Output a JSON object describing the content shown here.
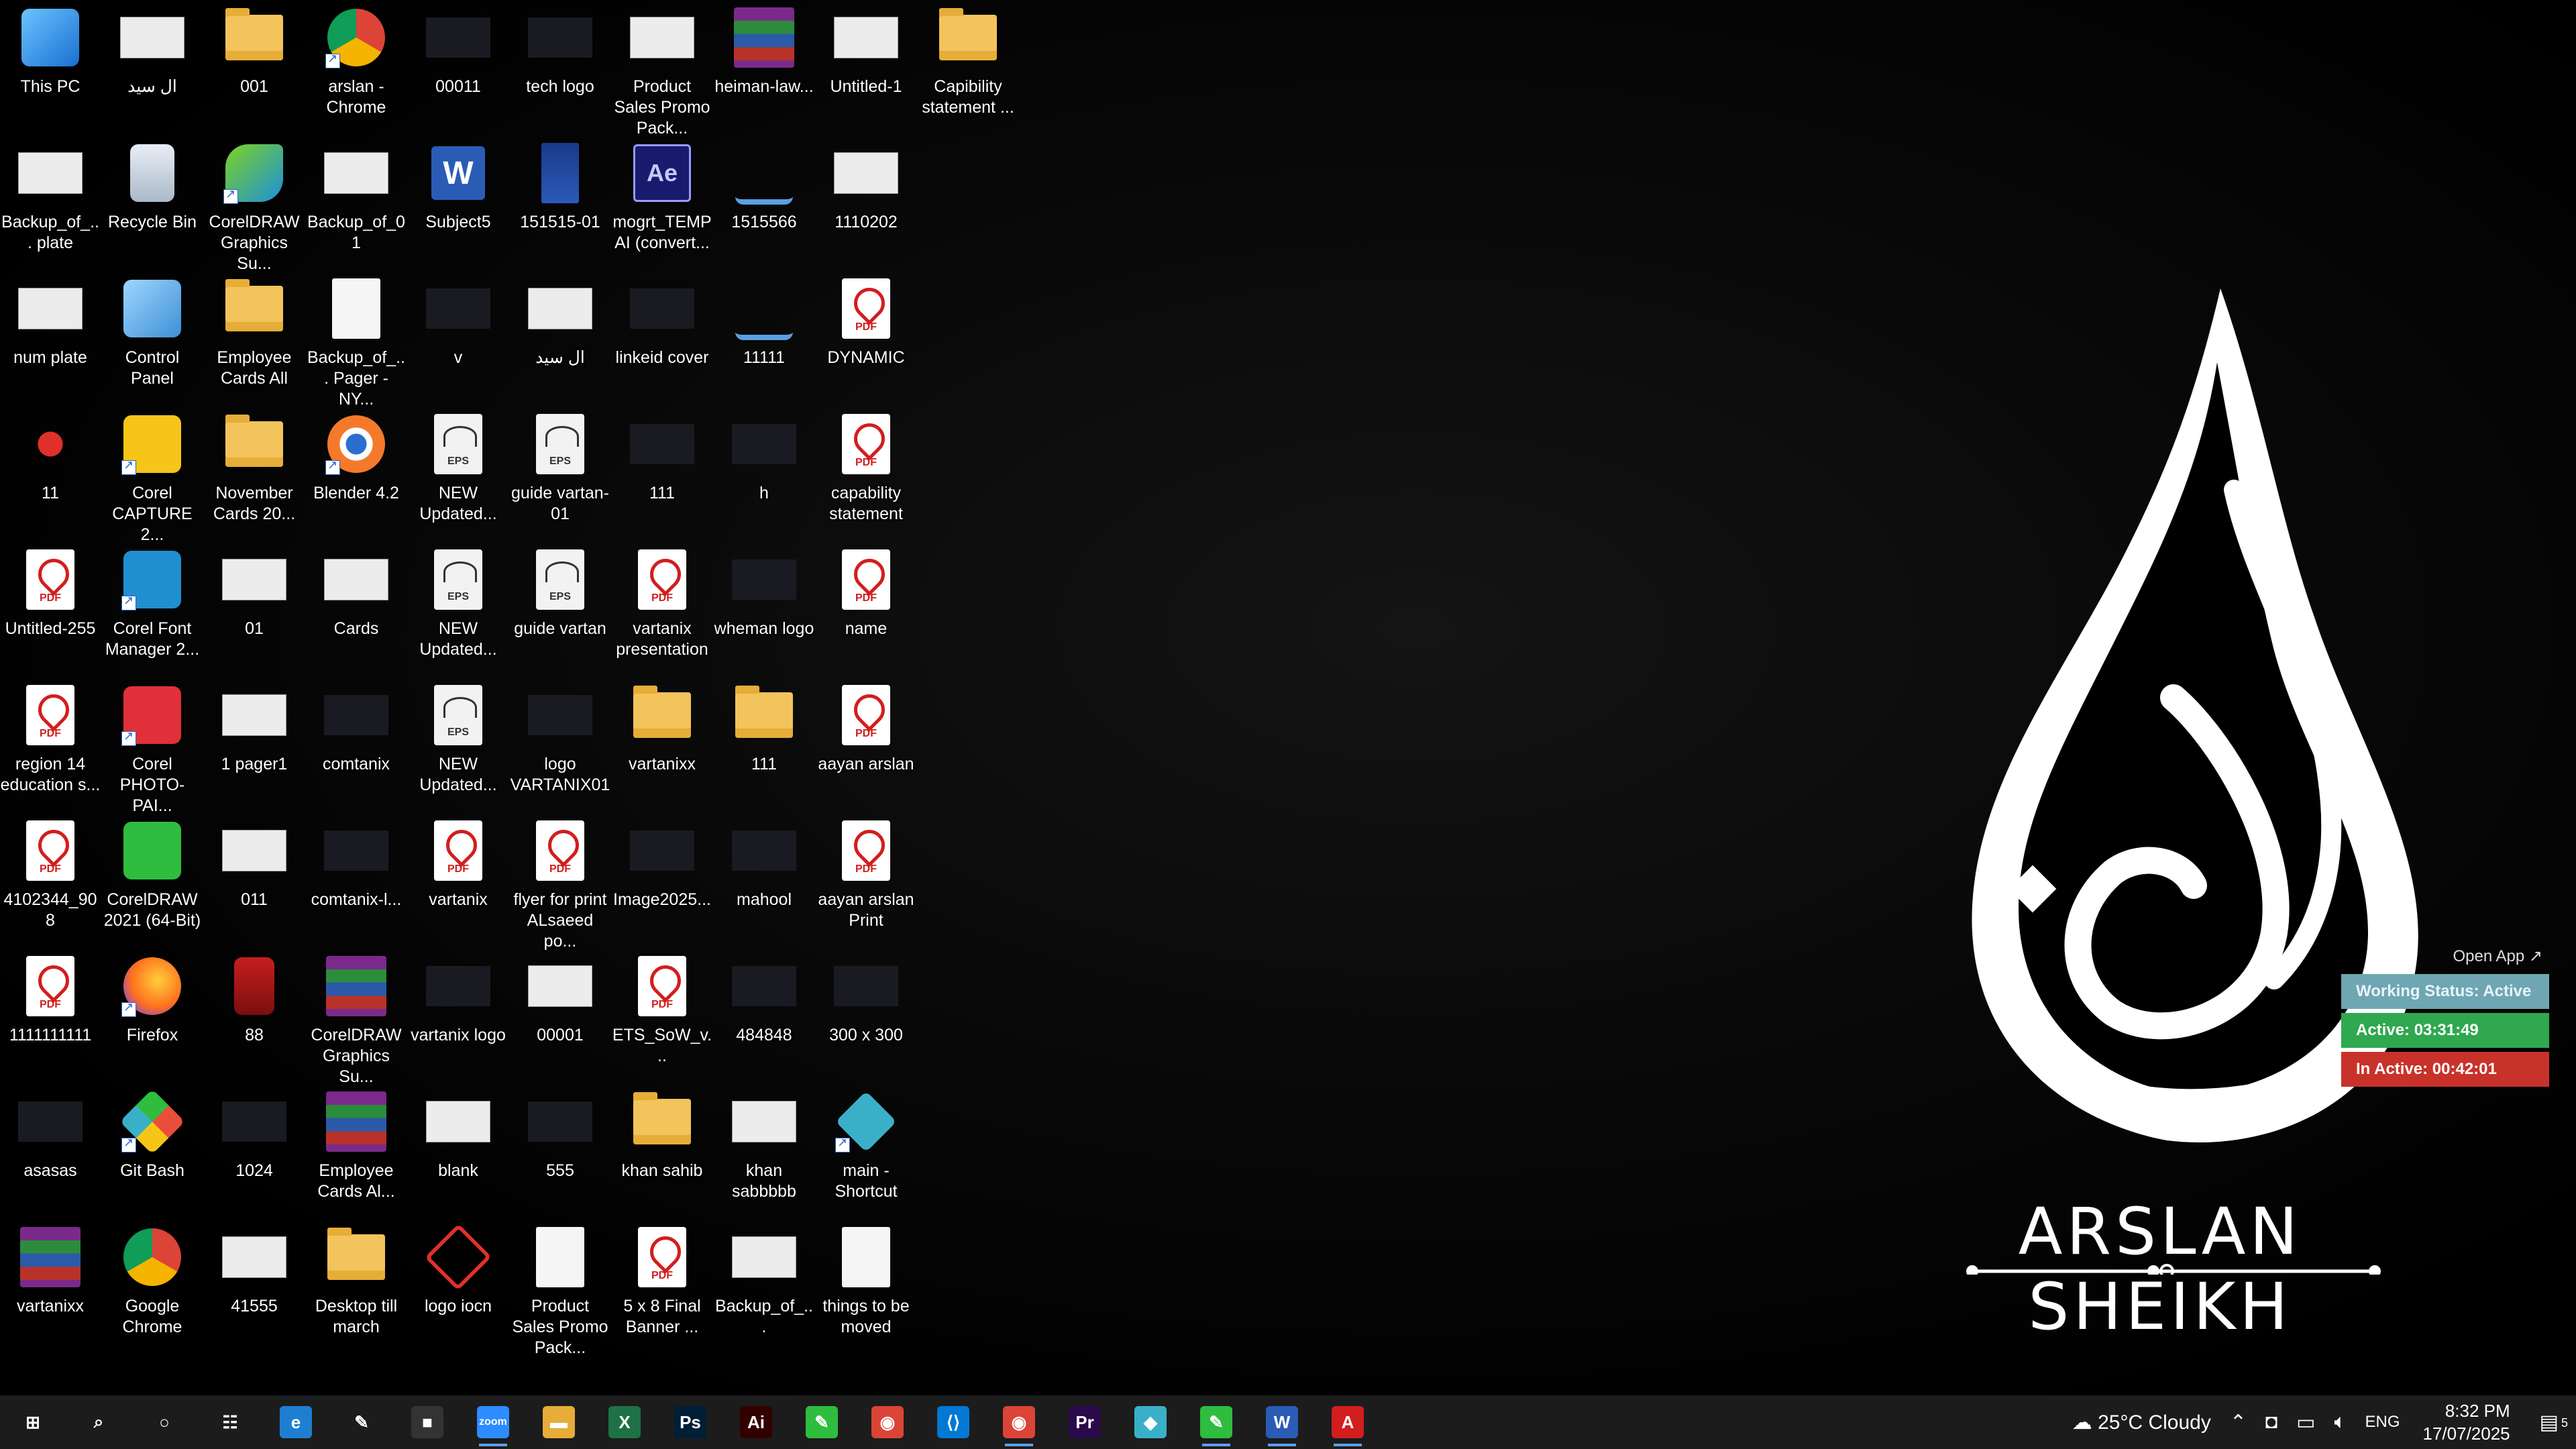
{
  "desktop": {
    "icons": [
      {
        "label": "This PC",
        "kind": "thispc",
        "col": 0,
        "row": 0
      },
      {
        "label": "ال سيد",
        "kind": "thumb",
        "col": 1,
        "row": 0
      },
      {
        "label": "001",
        "kind": "folder",
        "col": 2,
        "row": 0
      },
      {
        "label": "arslan - Chrome",
        "kind": "chrome",
        "col": 3,
        "row": 0,
        "shortcut": true
      },
      {
        "label": "00011",
        "kind": "dark",
        "col": 4,
        "row": 0
      },
      {
        "label": "tech logo",
        "kind": "dark",
        "col": 5,
        "row": 0
      },
      {
        "label": "Product Sales Promo Pack...",
        "kind": "thumb",
        "col": 6,
        "row": 0
      },
      {
        "label": "heiman-law...",
        "kind": "winrar",
        "col": 7,
        "row": 0
      },
      {
        "label": "Untitled-1",
        "kind": "thumb",
        "col": 8,
        "row": 0
      },
      {
        "label": "Capibility statement ...",
        "kind": "folder",
        "col": 9,
        "row": 0
      },
      {
        "label": "Backup_of_... plate",
        "kind": "thumb",
        "col": 0,
        "row": 1
      },
      {
        "label": "Recycle Bin",
        "kind": "recycle",
        "col": 1,
        "row": 1
      },
      {
        "label": "CorelDRAW Graphics Su...",
        "kind": "corel",
        "col": 2,
        "row": 1,
        "shortcut": true
      },
      {
        "label": "Backup_of_01",
        "kind": "thumb",
        "col": 3,
        "row": 1
      },
      {
        "label": "Subject5",
        "kind": "word",
        "col": 4,
        "row": 1
      },
      {
        "label": "151515-01",
        "kind": "bluedoc",
        "col": 5,
        "row": 1
      },
      {
        "label": "mogrt_TEMP AI (convert...",
        "kind": "ae",
        "col": 6,
        "row": 1
      },
      {
        "label": "1515566",
        "kind": "scales",
        "col": 7,
        "row": 1
      },
      {
        "label": "1110202",
        "kind": "thumb",
        "col": 8,
        "row": 1
      },
      {
        "label": "num plate",
        "kind": "thumb",
        "col": 0,
        "row": 2
      },
      {
        "label": "Control Panel",
        "kind": "control",
        "col": 1,
        "row": 2
      },
      {
        "label": "Employee Cards All",
        "kind": "folder",
        "col": 2,
        "row": 2
      },
      {
        "label": "Backup_of_... Pager - NY...",
        "kind": "doc",
        "col": 3,
        "row": 2
      },
      {
        "label": "v",
        "kind": "dark",
        "col": 4,
        "row": 2
      },
      {
        "label": "ال سيد",
        "kind": "thumb",
        "col": 5,
        "row": 2
      },
      {
        "label": "linkeid cover",
        "kind": "dark",
        "col": 6,
        "row": 2
      },
      {
        "label": "11111",
        "kind": "scales",
        "col": 7,
        "row": 2
      },
      {
        "label": "DYNAMIC",
        "kind": "pdf",
        "col": 8,
        "row": 2
      },
      {
        "label": "11",
        "kind": "red11",
        "col": 0,
        "row": 3
      },
      {
        "label": "Corel CAPTURE 2...",
        "kind": "capture",
        "col": 1,
        "row": 3,
        "shortcut": true
      },
      {
        "label": "November Cards 20...",
        "kind": "folder",
        "col": 2,
        "row": 3
      },
      {
        "label": "Blender 4.2",
        "kind": "blender",
        "col": 3,
        "row": 3,
        "shortcut": true
      },
      {
        "label": "NEW Updated...",
        "kind": "eps",
        "col": 4,
        "row": 3
      },
      {
        "label": "guide vartan-01",
        "kind": "eps",
        "col": 5,
        "row": 3
      },
      {
        "label": "111",
        "kind": "dark",
        "col": 6,
        "row": 3
      },
      {
        "label": "h",
        "kind": "dark",
        "col": 7,
        "row": 3
      },
      {
        "label": "capability statement",
        "kind": "pdf",
        "col": 8,
        "row": 3
      },
      {
        "label": "Untitled-255",
        "kind": "pdf",
        "col": 0,
        "row": 4
      },
      {
        "label": "Corel Font Manager 2...",
        "kind": "fontmgr",
        "col": 1,
        "row": 4,
        "shortcut": true
      },
      {
        "label": "01",
        "kind": "thumb",
        "col": 2,
        "row": 4
      },
      {
        "label": "Cards",
        "kind": "thumb",
        "col": 3,
        "row": 4
      },
      {
        "label": "NEW Updated...",
        "kind": "eps",
        "col": 4,
        "row": 4
      },
      {
        "label": "guide vartan",
        "kind": "eps",
        "col": 5,
        "row": 4
      },
      {
        "label": "vartanix presentation",
        "kind": "pdf",
        "col": 6,
        "row": 4
      },
      {
        "label": "wheman logo",
        "kind": "dark",
        "col": 7,
        "row": 4
      },
      {
        "label": "name",
        "kind": "pdf",
        "col": 8,
        "row": 4
      },
      {
        "label": "region 14 education s...",
        "kind": "pdf",
        "col": 0,
        "row": 5
      },
      {
        "label": "Corel PHOTO-PAI...",
        "kind": "photopaint",
        "col": 1,
        "row": 5,
        "shortcut": true
      },
      {
        "label": "1 pager1",
        "kind": "thumb",
        "col": 2,
        "row": 5
      },
      {
        "label": "comtanix",
        "kind": "dark",
        "col": 3,
        "row": 5
      },
      {
        "label": "NEW Updated...",
        "kind": "eps",
        "col": 4,
        "row": 5
      },
      {
        "label": "logo VARTANIX01",
        "kind": "dark",
        "col": 5,
        "row": 5
      },
      {
        "label": "vartanixx",
        "kind": "folder",
        "col": 6,
        "row": 5
      },
      {
        "label": "111",
        "kind": "folder",
        "col": 7,
        "row": 5
      },
      {
        "label": "aayan arslan",
        "kind": "pdf",
        "col": 8,
        "row": 5
      },
      {
        "label": "4102344_908",
        "kind": "pdf",
        "col": 0,
        "row": 6
      },
      {
        "label": "CorelDRAW 2021 (64-Bit)",
        "kind": "coreldraw",
        "col": 1,
        "row": 6
      },
      {
        "label": "011",
        "kind": "thumb",
        "col": 2,
        "row": 6
      },
      {
        "label": "comtanix-l...",
        "kind": "dark",
        "col": 3,
        "row": 6
      },
      {
        "label": "vartanix",
        "kind": "pdf",
        "col": 4,
        "row": 6
      },
      {
        "label": "flyer for print ALsaeed po...",
        "kind": "pdf",
        "col": 5,
        "row": 6
      },
      {
        "label": "Image2025...",
        "kind": "dark",
        "col": 6,
        "row": 6
      },
      {
        "label": "mahool",
        "kind": "dark",
        "col": 7,
        "row": 6
      },
      {
        "label": "aayan arslan Print",
        "kind": "pdf",
        "col": 8,
        "row": 6
      },
      {
        "label": "1111111111",
        "kind": "pdf",
        "col": 0,
        "row": 7
      },
      {
        "label": "Firefox",
        "kind": "firefox",
        "col": 1,
        "row": 7,
        "shortcut": true
      },
      {
        "label": "88",
        "kind": "red88",
        "col": 2,
        "row": 7
      },
      {
        "label": "CorelDRAW Graphics Su...",
        "kind": "winrar",
        "col": 3,
        "row": 7
      },
      {
        "label": "vartanix logo",
        "kind": "dark",
        "col": 4,
        "row": 7
      },
      {
        "label": "00001",
        "kind": "thumb",
        "col": 5,
        "row": 7
      },
      {
        "label": "ETS_SoW_v...",
        "kind": "pdf",
        "col": 6,
        "row": 7
      },
      {
        "label": "484848",
        "kind": "dark",
        "col": 7,
        "row": 7
      },
      {
        "label": "300 x 300",
        "kind": "dark",
        "col": 8,
        "row": 7
      },
      {
        "label": "asasas",
        "kind": "dark",
        "col": 0,
        "row": 8
      },
      {
        "label": "Git Bash",
        "kind": "gitbash",
        "col": 1,
        "row": 8,
        "shortcut": true
      },
      {
        "label": "1024",
        "kind": "dark",
        "col": 2,
        "row": 8
      },
      {
        "label": "Employee Cards Al...",
        "kind": "winrar",
        "col": 3,
        "row": 8
      },
      {
        "label": "blank",
        "kind": "thumb",
        "col": 4,
        "row": 8
      },
      {
        "label": "555",
        "kind": "dark",
        "col": 5,
        "row": 8
      },
      {
        "label": "khan sahib",
        "kind": "folder",
        "col": 6,
        "row": 8
      },
      {
        "label": "khan sabbbbb",
        "kind": "thumb",
        "col": 7,
        "row": 8
      },
      {
        "label": "main - Shortcut",
        "kind": "mainsc",
        "col": 8,
        "row": 8,
        "shortcut": true
      },
      {
        "label": "vartanixx",
        "kind": "winrar",
        "col": 0,
        "row": 9
      },
      {
        "label": "Google Chrome",
        "kind": "chrome",
        "col": 1,
        "row": 9
      },
      {
        "label": "41555",
        "kind": "thumb",
        "col": 2,
        "row": 9
      },
      {
        "label": "Desktop till march",
        "kind": "folder",
        "col": 3,
        "row": 9
      },
      {
        "label": "logo iocn",
        "kind": "logoiocn",
        "col": 4,
        "row": 9
      },
      {
        "label": "Product Sales Promo Pack...",
        "kind": "doc",
        "col": 5,
        "row": 9
      },
      {
        "label": "5 x 8 Final Banner ...",
        "kind": "pdf",
        "col": 6,
        "row": 9
      },
      {
        "label": "Backup_of_...",
        "kind": "thumb",
        "col": 7,
        "row": 9
      },
      {
        "label": "things to be moved",
        "kind": "doc",
        "col": 8,
        "row": 9
      }
    ]
  },
  "wallpaper": {
    "name_text": "ARSLAN SHEIKH"
  },
  "tracker_widget": {
    "open_app_label": "Open App ↗",
    "working_status": "Working Status: Active",
    "active": "Active: 03:31:49",
    "inactive": "In Active: 00:42:01"
  },
  "taskbar": {
    "apps": [
      {
        "name": "start-button",
        "glyph": "⊞",
        "color": "#1c1c1c",
        "open": false
      },
      {
        "name": "search-button",
        "glyph": "⌕",
        "color": "#1c1c1c",
        "open": false
      },
      {
        "name": "cortana-button",
        "glyph": "○",
        "color": "#1c1c1c",
        "open": false
      },
      {
        "name": "task-view-button",
        "glyph": "☷",
        "color": "#1c1c1c",
        "open": false
      },
      {
        "name": "edge-app",
        "glyph": "e",
        "color": "#1e7fd0",
        "open": false
      },
      {
        "name": "pen-app",
        "glyph": "✎",
        "color": "#1c1c1c",
        "open": false
      },
      {
        "name": "terminal-app",
        "glyph": "■",
        "color": "#333",
        "open": false
      },
      {
        "name": "zoom-app",
        "glyph": "zoom",
        "color": "#2d8cff",
        "open": true
      },
      {
        "name": "file-explorer-app",
        "glyph": "▬",
        "color": "#e6ad38",
        "open": false
      },
      {
        "name": "excel-app",
        "glyph": "X",
        "color": "#1e7145",
        "open": false
      },
      {
        "name": "photoshop-app",
        "glyph": "Ps",
        "color": "#001e36",
        "open": false
      },
      {
        "name": "illustrator-app",
        "glyph": "Ai",
        "color": "#330000",
        "open": false
      },
      {
        "name": "coreldraw-app",
        "glyph": "✎",
        "color": "#2ebd3e",
        "open": false
      },
      {
        "name": "chrome-app",
        "glyph": "◉",
        "color": "#db4437",
        "open": false
      },
      {
        "name": "vscode-app",
        "glyph": "⟨⟩",
        "color": "#0078d4",
        "open": false
      },
      {
        "name": "chrome-profile-app",
        "glyph": "◉",
        "color": "#db4437",
        "open": true
      },
      {
        "name": "premiere-app",
        "glyph": "Pr",
        "color": "#2a0a4a",
        "open": false
      },
      {
        "name": "main-app",
        "glyph": "◆",
        "color": "#3ab0c8",
        "open": false
      },
      {
        "name": "coreldraw-2-app",
        "glyph": "✎",
        "color": "#2ebd3e",
        "open": true
      },
      {
        "name": "word-app",
        "glyph": "W",
        "color": "#2b5cb5",
        "open": true
      },
      {
        "name": "acrobat-app",
        "glyph": "A",
        "color": "#d21e1e",
        "open": true
      }
    ],
    "weather": {
      "badge": "1",
      "text": "25°C  Cloudy"
    },
    "language": "ENG",
    "time": "8:32 PM",
    "date": "17/07/2025",
    "notifications": "5"
  }
}
